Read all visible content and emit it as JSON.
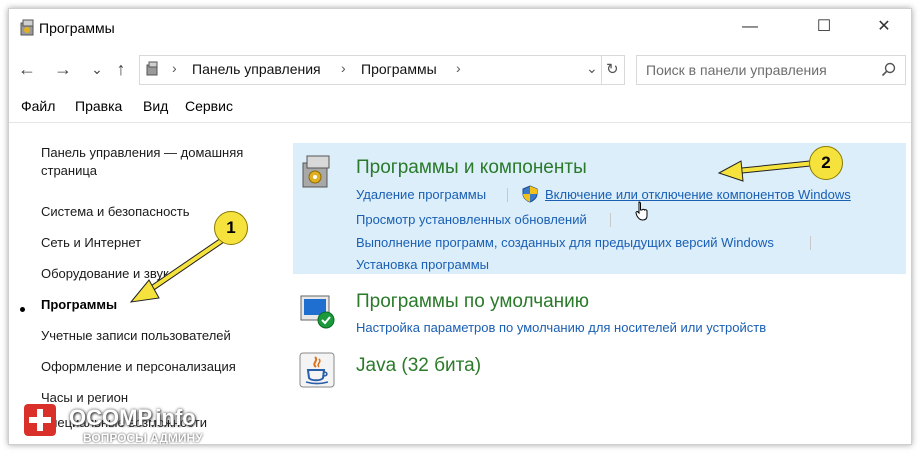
{
  "window": {
    "title": "Программы"
  },
  "controls": {
    "minimize": "—",
    "maximize": "☐",
    "close": "✕"
  },
  "nav": {
    "back": "←",
    "forward": "→",
    "recent": "⌄",
    "up": "↑",
    "breadcrumb": [
      "Панель управления",
      "Программы"
    ],
    "search_placeholder": "Поиск в панели управления"
  },
  "menu": [
    "Файл",
    "Правка",
    "Вид",
    "Сервис"
  ],
  "sidebar": {
    "items": [
      "Панель управления — домашняя",
      "страница",
      "Система и безопасность",
      "Сеть и Интернет",
      "Оборудование и звук",
      "Программы",
      "Учетные записи пользователей",
      "Оформление и персонализация",
      "Часы и регион",
      "Специальные возможности"
    ],
    "active_index": 5
  },
  "sections": [
    {
      "title": "Программы и компоненты",
      "links": [
        "Удаление программы",
        "Включение или отключение компонентов Windows",
        "Просмотр установленных обновлений",
        "Выполнение программ, созданных для предыдущих версий Windows",
        "Установка программы"
      ]
    },
    {
      "title": "Программы по умолчанию",
      "links": [
        "Настройка параметров по умолчанию для носителей или устройств"
      ]
    },
    {
      "title": "Java (32 бита)",
      "links": []
    }
  ],
  "annotations": {
    "badge1": "1",
    "badge2": "2"
  },
  "watermark": {
    "text": "OCOMP.info",
    "sub": "ВОПРОСЫ АДМИНУ"
  },
  "colors": {
    "accent_green": "#2a7a2a",
    "link_blue": "#1a5fb4",
    "panel_bg": "#dbeefa",
    "badge_yellow": "#f6e23c"
  }
}
